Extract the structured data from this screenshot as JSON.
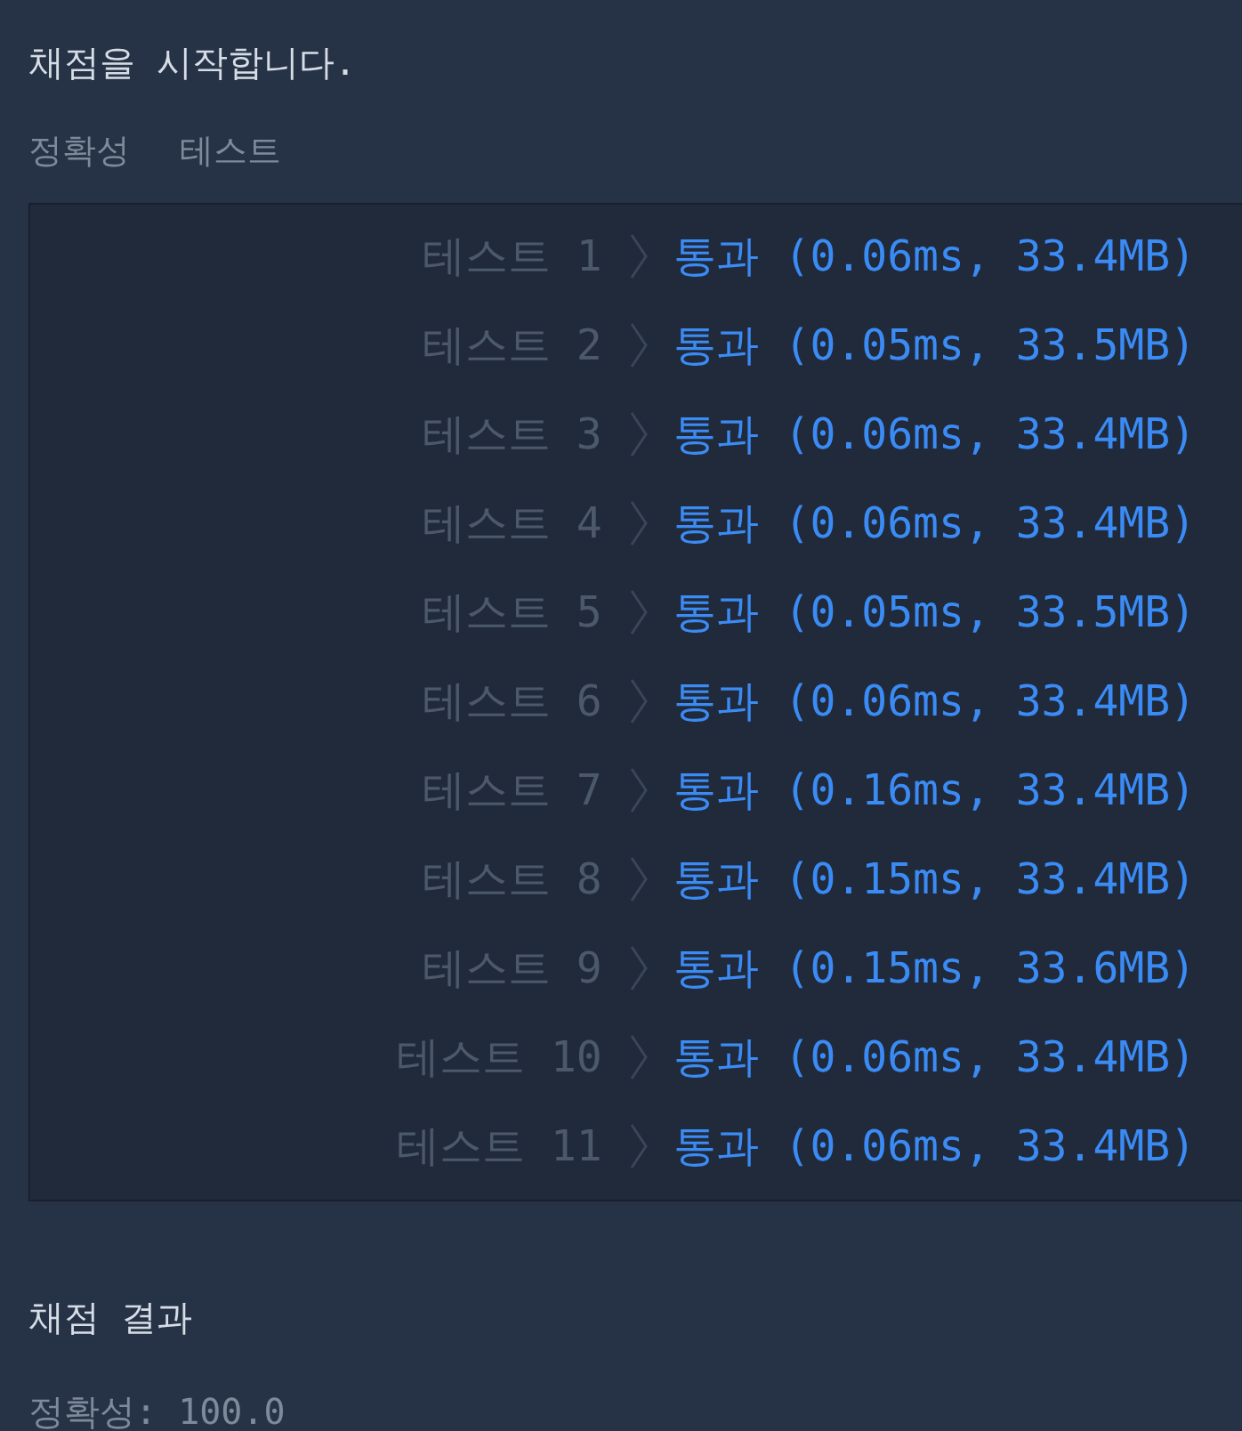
{
  "heading": "채점을 시작합니다.",
  "section_label": {
    "category": "정확성",
    "name": "테스트"
  },
  "tests": [
    {
      "label": "테스트 1",
      "result": "통과 (0.06ms, 33.4MB)"
    },
    {
      "label": "테스트 2",
      "result": "통과 (0.05ms, 33.5MB)"
    },
    {
      "label": "테스트 3",
      "result": "통과 (0.06ms, 33.4MB)"
    },
    {
      "label": "테스트 4",
      "result": "통과 (0.06ms, 33.4MB)"
    },
    {
      "label": "테스트 5",
      "result": "통과 (0.05ms, 33.5MB)"
    },
    {
      "label": "테스트 6",
      "result": "통과 (0.06ms, 33.4MB)"
    },
    {
      "label": "테스트 7",
      "result": "통과 (0.16ms, 33.4MB)"
    },
    {
      "label": "테스트 8",
      "result": "통과 (0.15ms, 33.4MB)"
    },
    {
      "label": "테스트 9",
      "result": "통과 (0.15ms, 33.6MB)"
    },
    {
      "label": "테스트 10",
      "result": "통과 (0.06ms, 33.4MB)"
    },
    {
      "label": "테스트 11",
      "result": "통과 (0.06ms, 33.4MB)"
    }
  ],
  "summary": {
    "title": "채점 결과",
    "score": "정확성: 100.0"
  }
}
